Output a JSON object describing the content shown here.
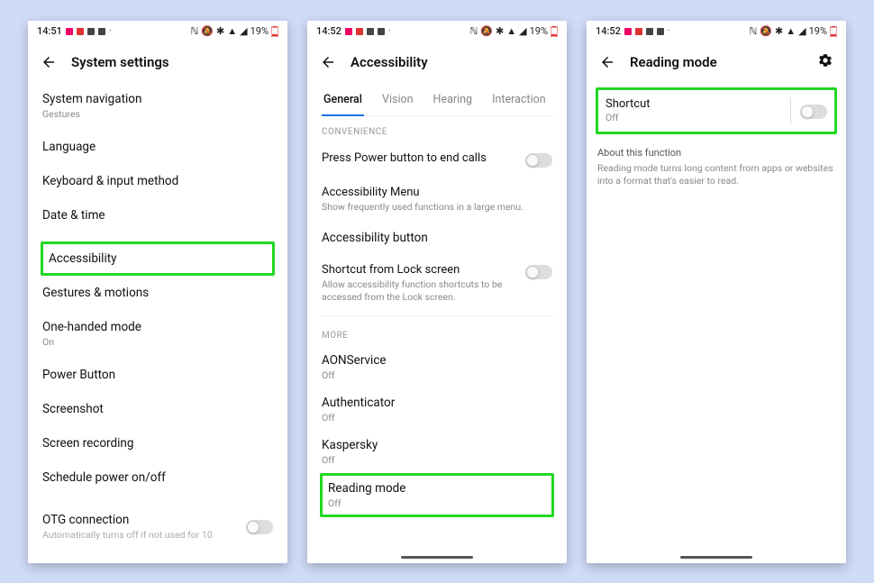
{
  "status": {
    "time1": "14:51",
    "time2": "14:52",
    "time3": "14:52",
    "battery": "19%"
  },
  "screen1": {
    "title": "System settings",
    "items": [
      {
        "label": "System navigation",
        "sub": "Gestures"
      },
      {
        "label": "Language"
      },
      {
        "label": "Keyboard & input method"
      },
      {
        "label": "Date & time"
      }
    ],
    "accessibility": {
      "label": "Accessibility"
    },
    "items2": [
      {
        "label": "Gestures & motions"
      },
      {
        "label": "One-handed mode",
        "sub": "On"
      },
      {
        "label": "Power Button"
      },
      {
        "label": "Screenshot"
      },
      {
        "label": "Screen recording"
      },
      {
        "label": "Schedule power on/off"
      }
    ],
    "otg": {
      "label": "OTG connection",
      "sub": "Automatically turns off if not used for 10"
    }
  },
  "screen2": {
    "title": "Accessibility",
    "tabs": [
      "General",
      "Vision",
      "Hearing",
      "Interaction"
    ],
    "convenience_header": "CONVENIENCE",
    "press_power": {
      "label": "Press Power button to end calls"
    },
    "acc_menu": {
      "label": "Accessibility Menu",
      "sub": "Show frequently used functions in a large menu."
    },
    "acc_button": {
      "label": "Accessibility button"
    },
    "shortcut_lock": {
      "label": "Shortcut from Lock screen",
      "sub": "Allow accessibility function shortcuts to be accessed from the Lock screen."
    },
    "more_header": "MORE",
    "more": [
      {
        "label": "AONService",
        "sub": "Off"
      },
      {
        "label": "Authenticator",
        "sub": "Off"
      },
      {
        "label": "Kaspersky",
        "sub": "Off"
      }
    ],
    "reading_mode": {
      "label": "Reading mode",
      "sub": "Off"
    }
  },
  "screen3": {
    "title": "Reading mode",
    "shortcut": {
      "label": "Shortcut",
      "sub": "Off"
    },
    "about": {
      "label": "About this function",
      "sub": "Reading mode turns long content from apps or websites into a format that's easier to read."
    }
  }
}
